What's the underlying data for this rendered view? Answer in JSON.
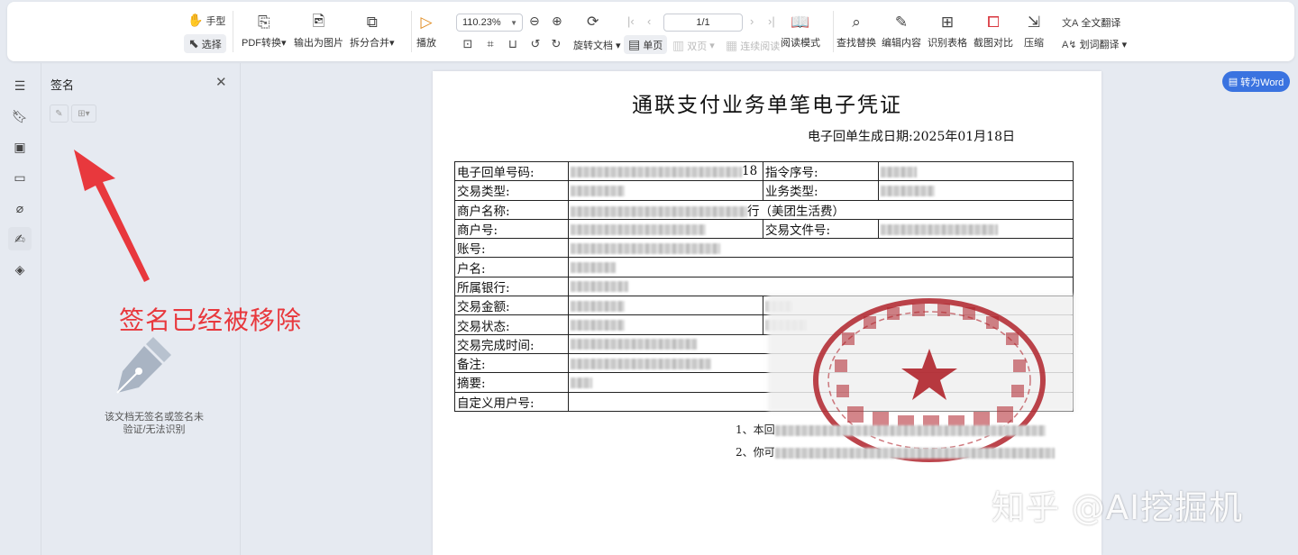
{
  "toolbar": {
    "hand_tool": "手型",
    "select_tool": "选择",
    "pdf_convert": "PDF转换",
    "export_image": "输出为图片",
    "split_merge": "拆分合并",
    "play": "播放",
    "zoom": "110.23%",
    "page_indicator": "1/1",
    "rotate": "旋转文档",
    "single_page": "单页",
    "double_page": "双页",
    "continuous": "连续阅读",
    "read_mode": "阅读模式",
    "find_replace": "查找替换",
    "edit_content": "编辑内容",
    "recognize_table": "识别表格",
    "compare": "截图对比",
    "compress": "压缩",
    "full_translate": "全文翻译",
    "word_translate": "划词翻译"
  },
  "sidebar": {
    "icons": [
      "outline-icon",
      "bookmark-icon",
      "thumbnail-icon",
      "comment-icon",
      "attachment-icon",
      "signature-icon",
      "layers-icon"
    ]
  },
  "panel": {
    "title": "签名",
    "empty_message_line1": "该文档无签名或签名未",
    "empty_message_line2": "验证/无法识别"
  },
  "annotation": {
    "text": "签名已经被移除",
    "color": "#e8383d"
  },
  "document": {
    "title": "通联支付业务单笔电子凭证",
    "date_label": "电子回单生成日期:",
    "date_value": "2025年01月18日",
    "rows": [
      {
        "l1": "电子回单号码:",
        "extra": "18",
        "l2": "指令序号:"
      },
      {
        "l1": "交易类型:",
        "l2": "业务类型:"
      },
      {
        "l1": "商户名称:",
        "extra": "行（美团生活费）"
      },
      {
        "l1": "商户号:",
        "l2": "交易文件号:"
      },
      {
        "l1": "账号:"
      },
      {
        "l1": "户名:"
      },
      {
        "l1": "所属银行:"
      },
      {
        "l1": "交易金额:"
      },
      {
        "l1": "交易状态:"
      },
      {
        "l1": "交易完成时间:"
      },
      {
        "l1": "备注:"
      },
      {
        "l1": "摘要:"
      },
      {
        "l1": "自定义用户号:"
      }
    ],
    "note1": "1、本回",
    "note2": "2、你可"
  },
  "convert_word": "转为Word",
  "watermark": "知乎 @AI挖掘机",
  "colors": {
    "accent": "#3a73e0",
    "stamp": "#b0232b"
  }
}
